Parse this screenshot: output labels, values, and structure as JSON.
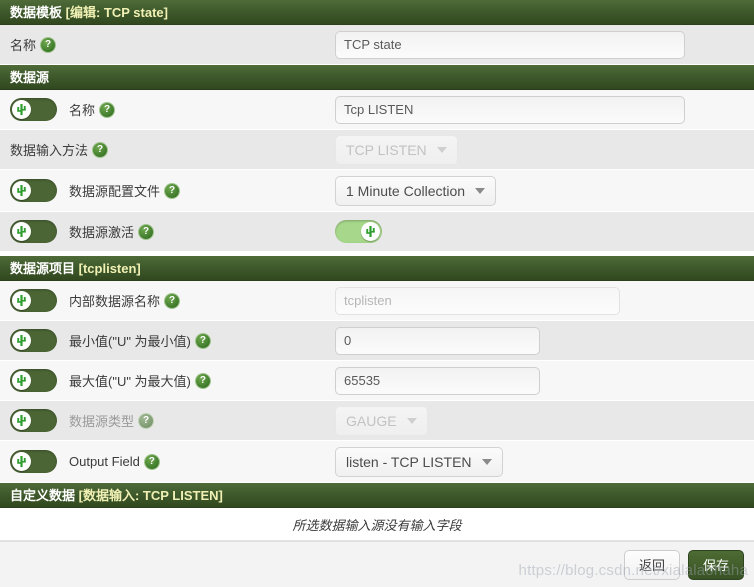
{
  "sections": {
    "template": {
      "title": "数据模板",
      "subtitle": "[编辑: TCP state]"
    },
    "data_source": {
      "title": "数据源",
      "subtitle": ""
    },
    "data_source_item": {
      "title": "数据源项目",
      "subtitle": "[tcplisten]"
    },
    "custom_data": {
      "title": "自定义数据",
      "subtitle": "[数据输入: TCP LISTEN]"
    }
  },
  "rows": {
    "template_name": {
      "label": "名称",
      "help": "?",
      "value": "TCP state"
    },
    "ds_name": {
      "label": "名称",
      "help": "?",
      "value": "Tcp LISTEN",
      "toggle": "off"
    },
    "ds_input_method": {
      "label": "数据输入方法",
      "help": "?",
      "value": "TCP LISTEN"
    },
    "ds_profile": {
      "label": "数据源配置文件",
      "help": "?",
      "value": "1 Minute Collection",
      "toggle": "off"
    },
    "ds_active": {
      "label": "数据源激活",
      "help": "?",
      "toggle": "on"
    },
    "internal_ds_name": {
      "label": "内部数据源名称",
      "help": "?",
      "value": "tcplisten",
      "toggle": "off"
    },
    "minimum_value": {
      "label": "最小值(\"U\" 为最小值)",
      "help": "?",
      "value": "0",
      "toggle": "off"
    },
    "maximum_value": {
      "label": "最大值(\"U\" 为最大值)",
      "help": "?",
      "value": "65535",
      "toggle": "off"
    },
    "ds_type": {
      "label": "数据源类型",
      "help": "?",
      "value": "GAUGE",
      "toggle": "off"
    },
    "output_field": {
      "label": "Output Field",
      "help": "?",
      "value": "listen - TCP LISTEN",
      "toggle": "off"
    }
  },
  "note": {
    "text": "所选数据输入源没有输入字段"
  },
  "footer": {
    "back_label": "返回",
    "save_label": "保存"
  },
  "watermark": {
    "text": "https://blog.csdn.net/xialalaohaha"
  },
  "colors": {
    "header_green": "#3f5a2c",
    "header_sub_text": "#f0f0b4",
    "toggle_off": "#4b6535",
    "toggle_on": "#a6d78a",
    "primary_button": "#3a5326",
    "row_alt_dark": "#e8e8e8",
    "row_alt_light": "#f7f7f7"
  },
  "icons": {
    "help": "help-circle-icon",
    "cactus": "cactus-icon",
    "caret": "chevron-down-icon"
  }
}
